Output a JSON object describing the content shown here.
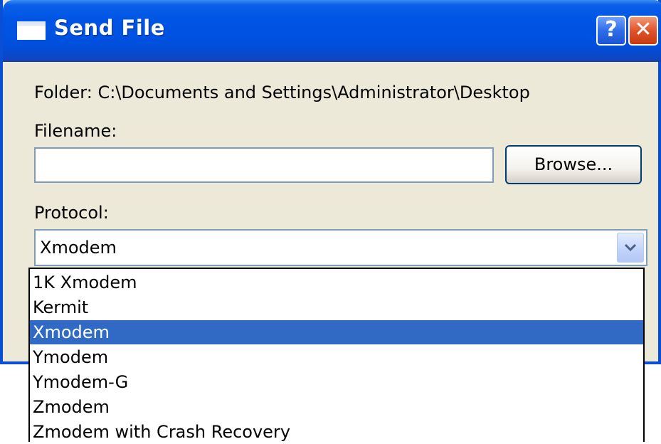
{
  "window": {
    "title": "Send File",
    "help_label": "?",
    "close_label": "✕"
  },
  "form": {
    "folder_text": "Folder:  C:\\Documents and Settings\\Administrator\\Desktop",
    "filename_label": "Filename:",
    "filename_value": "",
    "browse_label": "Browse...",
    "protocol_label": "Protocol:",
    "protocol_selected": "Xmodem"
  },
  "protocol_options": [
    {
      "label": "1K Xmodem",
      "selected": false
    },
    {
      "label": "Kermit",
      "selected": false
    },
    {
      "label": "Xmodem",
      "selected": true
    },
    {
      "label": "Ymodem",
      "selected": false
    },
    {
      "label": "Ymodem-G",
      "selected": false
    },
    {
      "label": "Zmodem",
      "selected": false
    },
    {
      "label": "Zmodem with Crash Recovery",
      "selected": false
    }
  ],
  "icons": {
    "title_icon": "window-icon",
    "help_icon": "help-icon",
    "close_icon": "close-icon",
    "dropdown_icon": "chevron-down-icon"
  },
  "colors": {
    "titlebar": "#0055e5",
    "selection": "#316ac5",
    "dialog_bg": "#ece9d8",
    "close_button": "#e1542a"
  }
}
